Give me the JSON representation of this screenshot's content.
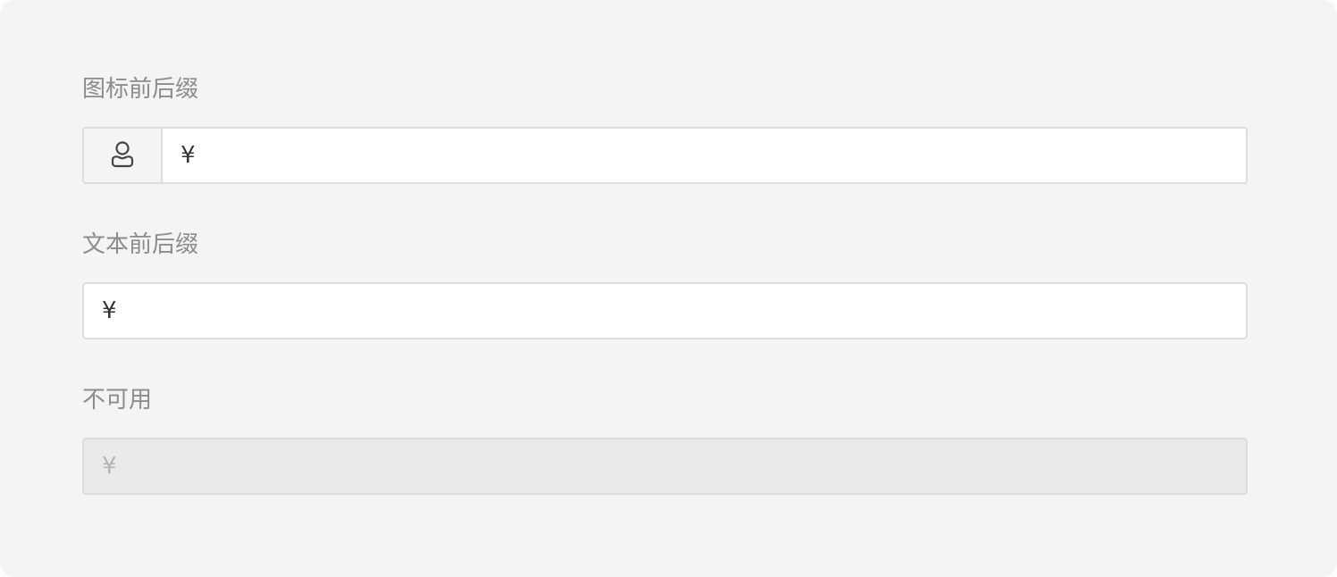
{
  "sections": [
    {
      "label": "图标前后缀",
      "prefix_icon": "user-icon",
      "prefix_text": "¥",
      "value": "",
      "disabled": false
    },
    {
      "label": "文本前后缀",
      "prefix_text": "¥",
      "value": "",
      "disabled": false
    },
    {
      "label": "不可用",
      "prefix_text": "¥",
      "value": "",
      "disabled": true
    }
  ],
  "colors": {
    "panel_background": "#f4f4f4",
    "label_text": "#8c8c8c",
    "field_border": "#dddddd",
    "disabled_background": "#eaeaea"
  }
}
